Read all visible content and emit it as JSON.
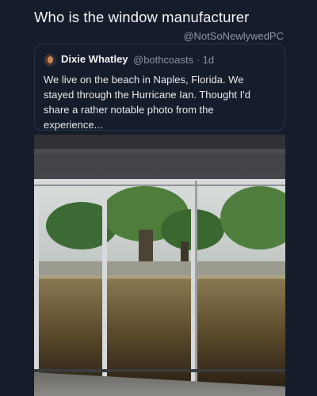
{
  "caption": "Who is the window manufacturer",
  "watermark": "@NotSoNewlywedPC",
  "tweet": {
    "author": "Dixie Whatley",
    "handle": "@bothcoasts",
    "separator": "·",
    "age": "1d",
    "lines": [
      "We live on the beach in Naples, Florida. We",
      "stayed through the Hurricane Ian.  Thought I'd",
      "share a rather notable photo from the",
      "experience..."
    ]
  },
  "colors": {
    "background": "#151c2a",
    "card_border": "#2b3445",
    "muted": "#8a93a3"
  }
}
